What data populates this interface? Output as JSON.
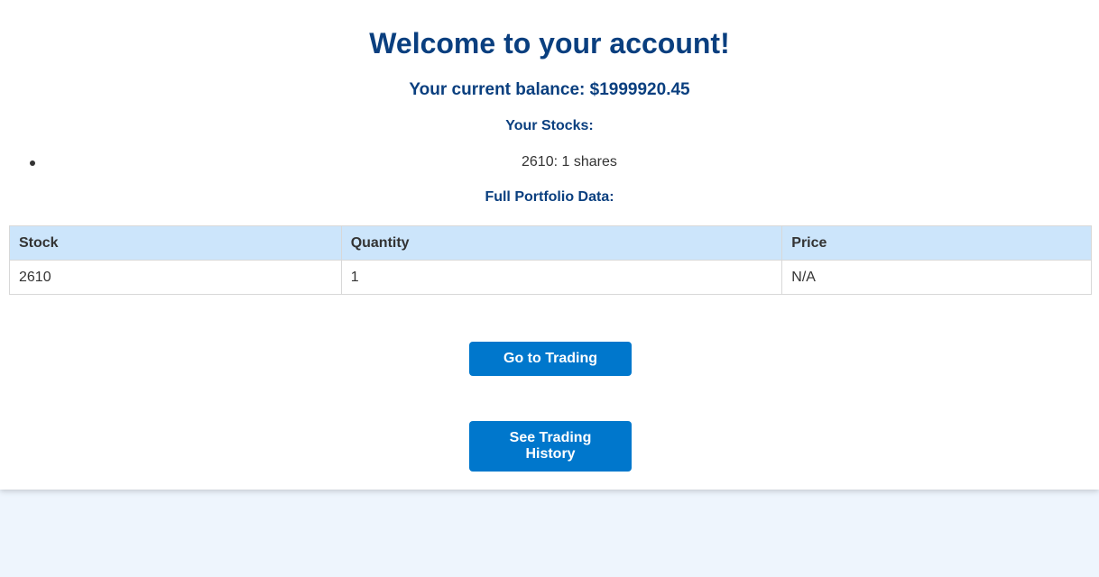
{
  "header": {
    "title": "Welcome to your account!",
    "balance_label": "Your current balance: ",
    "balance_value": "$1999920.45"
  },
  "stocks": {
    "heading": "Your Stocks:",
    "items": [
      {
        "text": "2610: 1 shares"
      }
    ]
  },
  "portfolio": {
    "heading": "Full Portfolio Data:",
    "columns": [
      "Stock",
      "Quantity",
      "Price"
    ],
    "rows": [
      [
        "2610",
        "1",
        "N/A"
      ]
    ]
  },
  "actions": {
    "trading_label": "Go to Trading",
    "history_label": "See Trading History"
  },
  "colors": {
    "heading": "#0a3f7f",
    "button": "#0077cc",
    "table_header": "#cce5fb",
    "page_background": "#eef5fd"
  }
}
